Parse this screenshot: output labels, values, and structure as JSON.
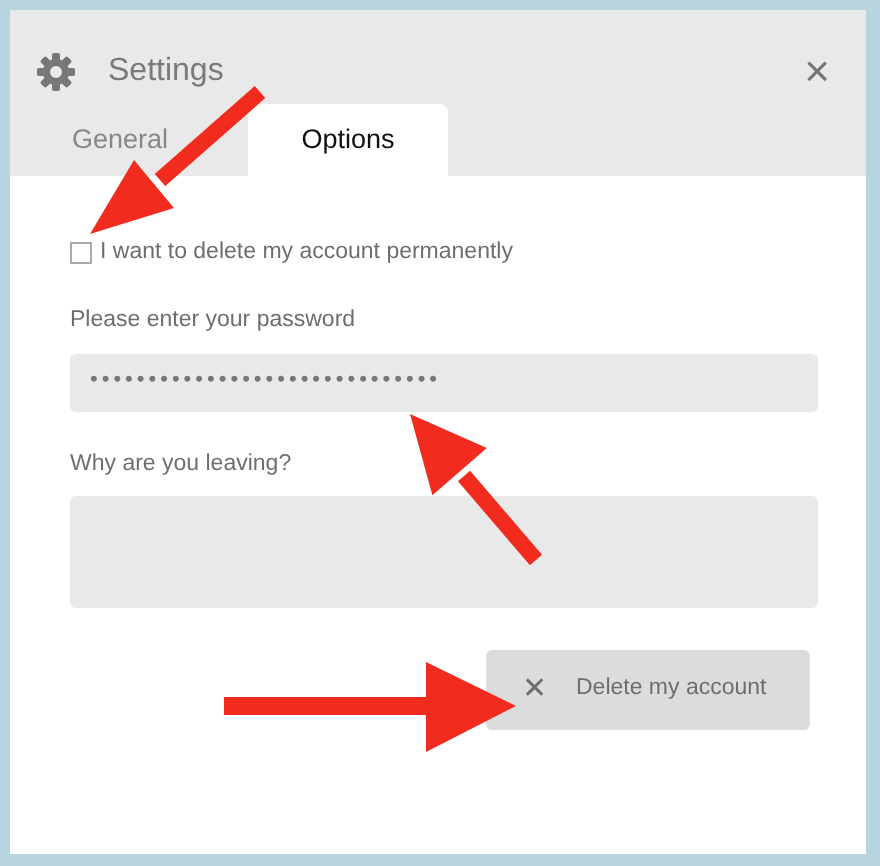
{
  "window": {
    "title": "Settings",
    "close": "×"
  },
  "tabs": [
    {
      "label": "General",
      "selected": false
    },
    {
      "label": "Options",
      "selected": true
    }
  ],
  "delete_checkbox": {
    "label": "I want to delete my account permanently",
    "checked": false
  },
  "password": {
    "label": "Please enter your password",
    "value": "••••••••••••••••••••••••••••••"
  },
  "reason": {
    "label": "Why are you leaving?"
  },
  "delete_button": {
    "label": "Delete my account",
    "icon": "✕"
  }
}
